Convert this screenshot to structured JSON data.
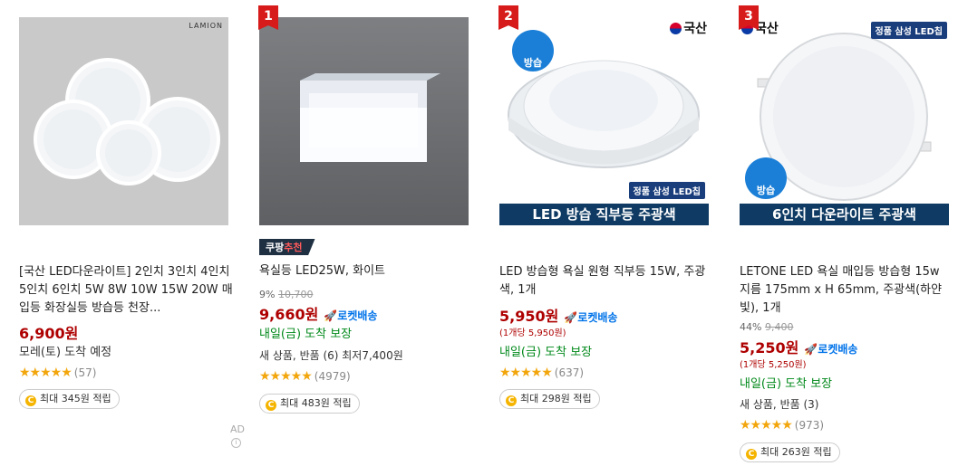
{
  "ad_label": "AD",
  "products": [
    {
      "title": "[국산 LED다운라이트] 2인치 3인치 4인치 5인치 6인치 5W 8W 10W 15W 20W 매입등 화장실등 방습등 천장...",
      "image_brand": "LAMION",
      "price": "6,900원",
      "arrival": "모레(토) 도착 예정",
      "rating_count": "(57)",
      "points": "최대 345원 적립"
    },
    {
      "rank": "1",
      "badge": {
        "a": "쿠팡",
        "b": "추천"
      },
      "title": "욕실등 LED25W, 화이트",
      "discount": "9%",
      "original_price": "10,700",
      "price": "9,660원",
      "rocket": "로켓배송",
      "arrival": "내일(금) 도착 보장",
      "extra": "새 상품, 반품 (6) 최저7,400원",
      "rating_count": "(4979)",
      "points": "최대 483원 적립"
    },
    {
      "rank": "2",
      "title": "LED 방습형 욕실 원형 직부등 15W, 주광색, 1개",
      "price": "5,950원",
      "rocket": "로켓배송",
      "unit_price": "(1개당 5,950원)",
      "arrival": "내일(금) 도착 보장",
      "rating_count": "(637)",
      "points": "최대 298원 적립",
      "image": {
        "flag": "국산",
        "drop": "방습",
        "samsung_a": "정품",
        "samsung_b": "삼성 LED칩",
        "banner": "LED 방습 직부등 주광색"
      }
    },
    {
      "rank": "3",
      "title": "LETONE LED 욕실 매입등 방습형 15w 지름 175mm x H 65mm, 주광색(하얀빛), 1개",
      "discount": "44%",
      "original_price": "9,400",
      "price": "5,250원",
      "rocket": "로켓배송",
      "unit_price": "(1개당 5,250원)",
      "arrival": "내일(금) 도착 보장",
      "extra": "새 상품, 반품 (3)",
      "rating_count": "(973)",
      "points": "최대 263원 적립",
      "image": {
        "flag": "국산",
        "drop": "방습",
        "samsung_a": "정품",
        "samsung_b": "삼성 LED칩",
        "banner": "6인치 다운라이트 주광색"
      }
    }
  ],
  "colors": {
    "price": "#ae0000",
    "arrival": "#00891a",
    "rocket": "#0073e9",
    "rank": "#d71b1b",
    "star": "#f2a60c"
  }
}
